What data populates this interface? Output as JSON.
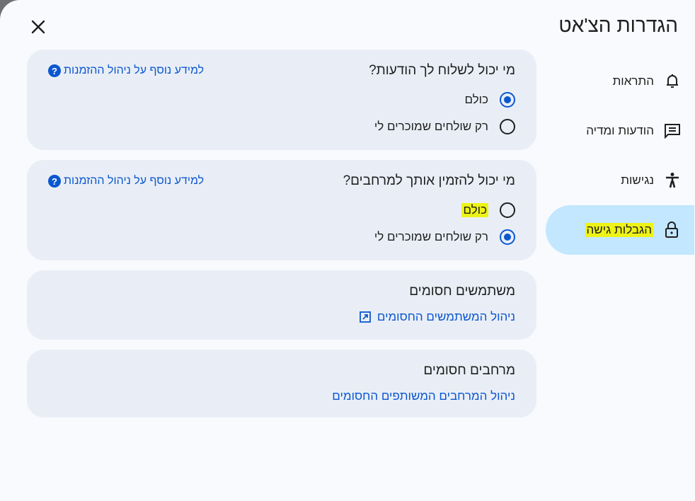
{
  "dialog": {
    "title": "הגדרות הצ'אט",
    "close_label": "×"
  },
  "nav": {
    "items": [
      {
        "label": "התראות",
        "icon": "bell-icon"
      },
      {
        "label": "הודעות ומדיה",
        "icon": "message-icon"
      },
      {
        "label": "נגישות",
        "icon": "accessibility-icon"
      },
      {
        "label": "הגבלות גישה",
        "icon": "lock-icon",
        "active": true
      }
    ]
  },
  "cards": {
    "messages": {
      "title": "מי יכול לשלוח לך הודעות?",
      "help": "למידע נוסף על ניהול ההזמנות",
      "options": [
        {
          "label": "כולם",
          "selected": true
        },
        {
          "label": "רק שולחים שמוכרים לי",
          "selected": false
        }
      ]
    },
    "spaces": {
      "title": "מי יכול להזמין אותך למרחבים?",
      "help": "למידע נוסף על ניהול ההזמנות",
      "options": [
        {
          "label": "כולם",
          "selected": false
        },
        {
          "label": "רק שולחים שמוכרים לי",
          "selected": true
        }
      ]
    },
    "blocked_users": {
      "title": "משתמשים חסומים",
      "link": "ניהול המשתמשים החסומים"
    },
    "blocked_spaces": {
      "title": "מרחבים חסומים",
      "link": "ניהול המרחבים המשותפים החסומים"
    }
  },
  "colors": {
    "accent": "#0b57d0",
    "nav_active": "#c2e7ff",
    "card_bg": "#e9eef6",
    "highlight": "#eef316"
  }
}
